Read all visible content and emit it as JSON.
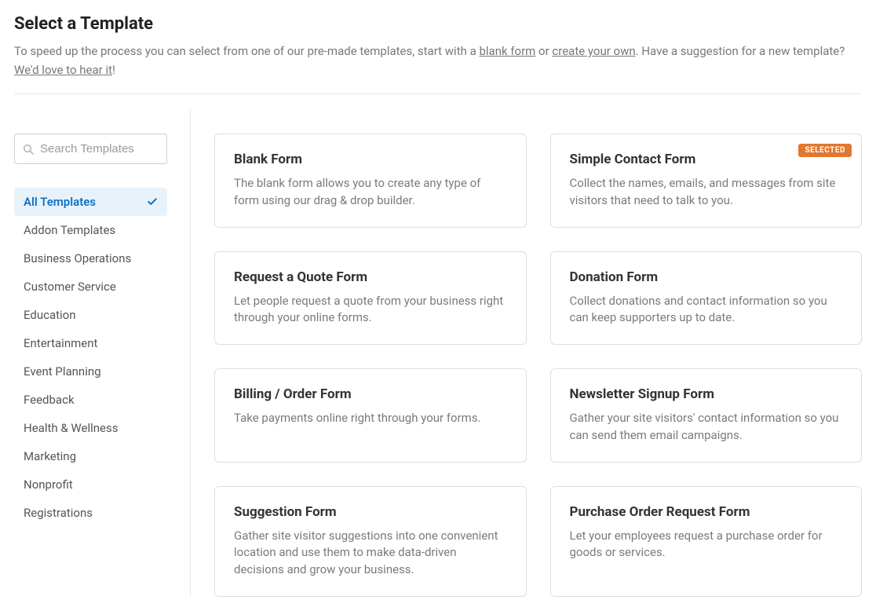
{
  "header": {
    "title": "Select a Template",
    "subtitle_parts": {
      "p1": "To speed up the process you can select from one of our pre-made templates, start with a ",
      "link1": "blank form",
      "p2": " or ",
      "link2": "create your own",
      "p3": ". Have a suggestion for a new template? ",
      "link3": "We'd love to hear it",
      "p4": "!"
    }
  },
  "search": {
    "placeholder": "Search Templates"
  },
  "categories": [
    {
      "label": "All Templates",
      "active": true
    },
    {
      "label": "Addon Templates",
      "active": false
    },
    {
      "label": "Business Operations",
      "active": false
    },
    {
      "label": "Customer Service",
      "active": false
    },
    {
      "label": "Education",
      "active": false
    },
    {
      "label": "Entertainment",
      "active": false
    },
    {
      "label": "Event Planning",
      "active": false
    },
    {
      "label": "Feedback",
      "active": false
    },
    {
      "label": "Health & Wellness",
      "active": false
    },
    {
      "label": "Marketing",
      "active": false
    },
    {
      "label": "Nonprofit",
      "active": false
    },
    {
      "label": "Registrations",
      "active": false
    }
  ],
  "selected_badge_label": "SELECTED",
  "templates": [
    {
      "title": "Blank Form",
      "desc": "The blank form allows you to create any type of form using our drag & drop builder.",
      "selected": false
    },
    {
      "title": "Simple Contact Form",
      "desc": "Collect the names, emails, and messages from site visitors that need to talk to you.",
      "selected": true
    },
    {
      "title": "Request a Quote Form",
      "desc": "Let people request a quote from your business right through your online forms.",
      "selected": false
    },
    {
      "title": "Donation Form",
      "desc": "Collect donations and contact information so you can keep supporters up to date.",
      "selected": false
    },
    {
      "title": "Billing / Order Form",
      "desc": "Take payments online right through your forms.",
      "selected": false
    },
    {
      "title": "Newsletter Signup Form",
      "desc": "Gather your site visitors' contact information so you can send them email campaigns.",
      "selected": false
    },
    {
      "title": "Suggestion Form",
      "desc": "Gather site visitor suggestions into one convenient location and use them to make data-driven decisions and grow your business.",
      "selected": false
    },
    {
      "title": "Purchase Order Request Form",
      "desc": "Let your employees request a purchase order for goods or services.",
      "selected": false
    }
  ]
}
